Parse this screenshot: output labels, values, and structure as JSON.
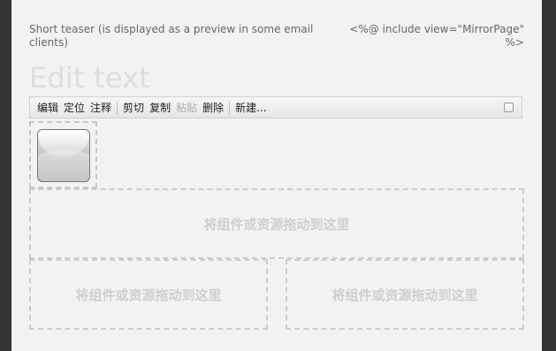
{
  "header": {
    "teaser": "Short teaser (is displayed as a preview in some email clients)",
    "include": "<%@ include view=\"MirrorPage\" %>"
  },
  "title": "Edit text",
  "toolbar": {
    "edit": "编辑",
    "locate": "定位",
    "annotate": "注释",
    "cut": "剪切",
    "copy": "复制",
    "paste": "粘贴",
    "delete": "删除",
    "new": "新建..."
  },
  "drop_zones": {
    "main": "将组件或资源拖动到这里",
    "left": "将组件或资源拖动到这里",
    "right": "将组件或资源拖动到这里"
  },
  "icons": {
    "component": "image-component-icon",
    "checkbox": "checkbox-icon"
  }
}
